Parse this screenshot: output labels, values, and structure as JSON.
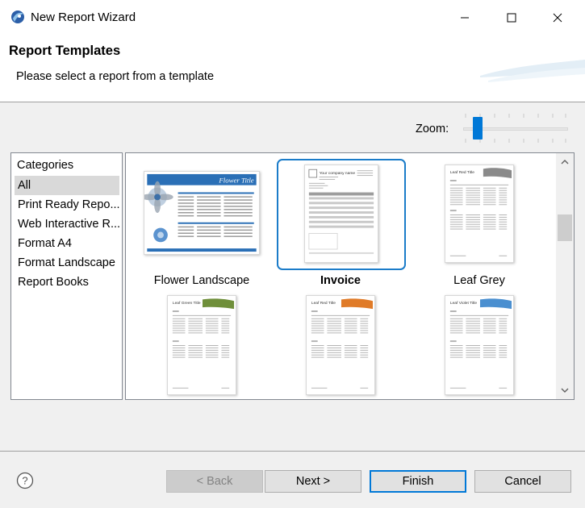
{
  "window": {
    "title": "New Report Wizard",
    "icons": {
      "app": "report-wizard-icon",
      "minimize": "minimize-icon",
      "maximize": "maximize-icon",
      "close": "close-icon"
    }
  },
  "header": {
    "title": "Report Templates",
    "description": "Please select a report from a template"
  },
  "zoom": {
    "label": "Zoom:",
    "level": 0.08
  },
  "categories": {
    "heading": "Categories",
    "selected": "All",
    "items": [
      {
        "label": "All"
      },
      {
        "label": "Print Ready Repo..."
      },
      {
        "label": "Web Interactive R..."
      },
      {
        "label": "Format A4"
      },
      {
        "label": "Format Landscape"
      },
      {
        "label": "Report Books"
      }
    ]
  },
  "templates": {
    "selected": "Invoice",
    "items": [
      {
        "label": "Flower Landscape",
        "thumb_title": "Flower Title"
      },
      {
        "label": "Invoice",
        "thumb_title": "Your company name"
      },
      {
        "label": "Leaf Grey",
        "thumb_title": "Leaf Red Title"
      },
      {
        "label": "",
        "thumb_title": "Leaf Green Title"
      },
      {
        "label": "",
        "thumb_title": "Leaf Red Title"
      },
      {
        "label": "",
        "thumb_title": "Leaf Violet Title"
      }
    ]
  },
  "footer": {
    "help_icon": "help-icon",
    "back_label": "< Back",
    "next_label": "Next >",
    "finish_label": "Finish",
    "cancel_label": "Cancel"
  },
  "colors": {
    "accent": "#0078d7",
    "selection_frame": "#1b7cc9",
    "flower_blue": "#2a6fb6",
    "leaf_grey": "#8a8a8a",
    "leaf_orange": "#e07b28",
    "leaf_green": "#6f8f3a",
    "leaf_violet": "#4a8fd0"
  }
}
